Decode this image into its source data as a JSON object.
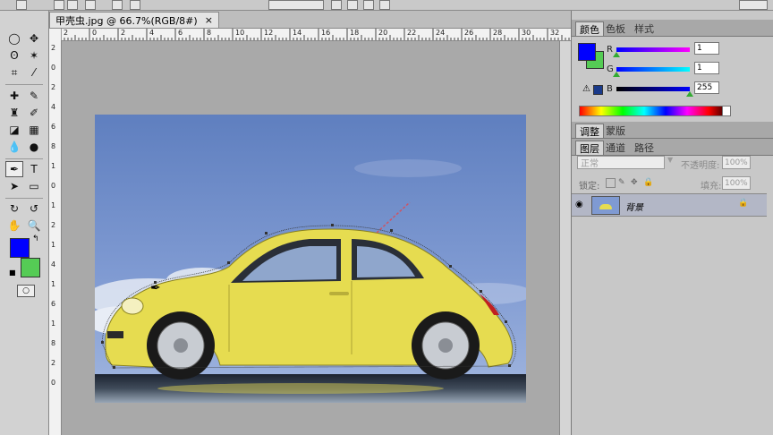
{
  "document": {
    "tab_title": "甲壳虫.jpg @ 66.7%(RGB/8#)",
    "close_symbol": "×",
    "ruler_h_labels": [
      "2",
      "0",
      "2",
      "4",
      "6",
      "8",
      "10",
      "12",
      "14",
      "16",
      "18",
      "20",
      "22",
      "24",
      "26",
      "28",
      "30",
      "32"
    ],
    "ruler_v_labels": [
      "2",
      "0",
      "2",
      "4",
      "6",
      "8",
      "1",
      "0",
      "1",
      "2",
      "1",
      "4",
      "1",
      "6",
      "1",
      "8",
      "2",
      "0"
    ]
  },
  "panels": {
    "color_tabs": [
      "颜色",
      "色板",
      "样式"
    ],
    "color": {
      "r_label": "R",
      "r_value": "1",
      "g_label": "G",
      "g_value": "1",
      "b_label": "B",
      "b_value": "255",
      "foreground": "#0000ff",
      "background": "#55cc55"
    },
    "adjust_tabs": [
      "调整",
      "蒙版"
    ],
    "layers_tabs": [
      "图层",
      "通道",
      "路径"
    ],
    "blend_mode": "正常",
    "opacity_label": "不透明度:",
    "opacity_value": "100%",
    "lock_label": "锁定:",
    "fill_label": "填充:",
    "fill_value": "100%",
    "layer_name": "背景"
  },
  "tools": {
    "foreground": "#0000ff",
    "background": "#55cc55"
  }
}
